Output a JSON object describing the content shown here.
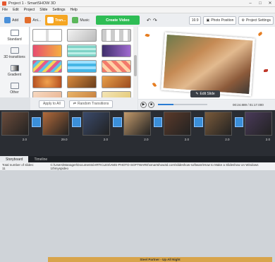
{
  "window": {
    "title": "Project 1 - SmartSHOW 3D"
  },
  "menu": [
    "File",
    "Edit",
    "Project",
    "Slide",
    "Settings",
    "Help"
  ],
  "toolbar": {
    "add_label": "Add",
    "animation_label": "Ani...",
    "transitions_label": "Tran...",
    "music_label": "Music",
    "create_video_label": "Create Video"
  },
  "right_toolbar": {
    "aspect_label": "16:9",
    "photo_position_label": "Photo Position",
    "project_settings_label": "Project Settings"
  },
  "categories": [
    "Standard",
    "3D transitions",
    "Gradient",
    "Other"
  ],
  "left_buttons": {
    "apply_all_label": "Apply to All",
    "random_label": "Random Transitions"
  },
  "preview": {
    "edit_slide_label": "Edit Slide"
  },
  "player": {
    "time": "00:24.889 / 01:17.000",
    "progress": 0.32
  },
  "timeline": {
    "slides": [
      {
        "caption": "2.0"
      },
      {
        "caption": "29.0"
      },
      {
        "caption": "2.0"
      },
      {
        "caption": "2.0"
      },
      {
        "caption": "2.0"
      },
      {
        "caption": "2.0"
      },
      {
        "caption": "2.0"
      }
    ],
    "music_track": "Steel Partner - Up All Night"
  },
  "tabs": [
    "Storyboard",
    "Timeline"
  ],
  "status": {
    "count": "Total number of slides: 11",
    "path": "C:\\Users\\Manager\\Documents\\ARTICLES\\AMS-PHOTO-SOFTWARE\\smartshow3d.com\\slideshow-software\\How to Make a Slideshow on Windows 10\\myspideo"
  },
  "colors": {
    "accent": "#f5a623",
    "create": "#2ebd55",
    "music": "#d8a44b",
    "transition": "#3b8fd9"
  }
}
